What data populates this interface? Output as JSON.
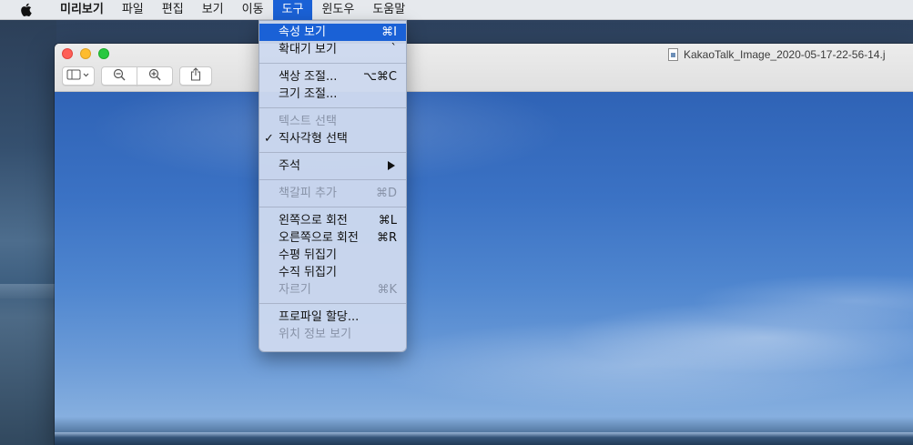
{
  "menubar": {
    "app_name": "미리보기",
    "items": [
      "파일",
      "편집",
      "보기",
      "이동",
      "도구",
      "윈도우",
      "도움말"
    ],
    "active": "도구"
  },
  "window": {
    "title": "KakaoTalk_Image_2020-05-17-22-56-14.j"
  },
  "tools_menu": {
    "items": [
      {
        "label": "속성 보기",
        "shortcut": "⌘I",
        "state": "highlighted"
      },
      {
        "label": "확대기 보기",
        "shortcut": "`",
        "state": "enabled"
      },
      {
        "label": "색상 조절...",
        "shortcut": "⌥⌘C",
        "state": "enabled"
      },
      {
        "label": "크기 조절...",
        "shortcut": "",
        "state": "enabled"
      },
      {
        "label": "텍스트 선택",
        "shortcut": "",
        "state": "disabled"
      },
      {
        "label": "직사각형 선택",
        "shortcut": "",
        "state": "checked",
        "check": "✓"
      },
      {
        "label": "주석",
        "shortcut": "",
        "state": "submenu"
      },
      {
        "label": "책갈피 추가",
        "shortcut": "⌘D",
        "state": "disabled"
      },
      {
        "label": "왼쪽으로 회전",
        "shortcut": "⌘L",
        "state": "enabled"
      },
      {
        "label": "오른쪽으로 회전",
        "shortcut": "⌘R",
        "state": "enabled"
      },
      {
        "label": "수평 뒤집기",
        "shortcut": "",
        "state": "enabled"
      },
      {
        "label": "수직 뒤집기",
        "shortcut": "",
        "state": "enabled"
      },
      {
        "label": "자르기",
        "shortcut": "⌘K",
        "state": "disabled"
      },
      {
        "label": "프로파일 할당...",
        "shortcut": "",
        "state": "enabled"
      },
      {
        "label": "위치 정보 보기",
        "shortcut": "",
        "state": "disabled"
      }
    ]
  },
  "colors": {
    "highlight": "#1a61d6",
    "menu_bg": "#cdd8ee"
  }
}
